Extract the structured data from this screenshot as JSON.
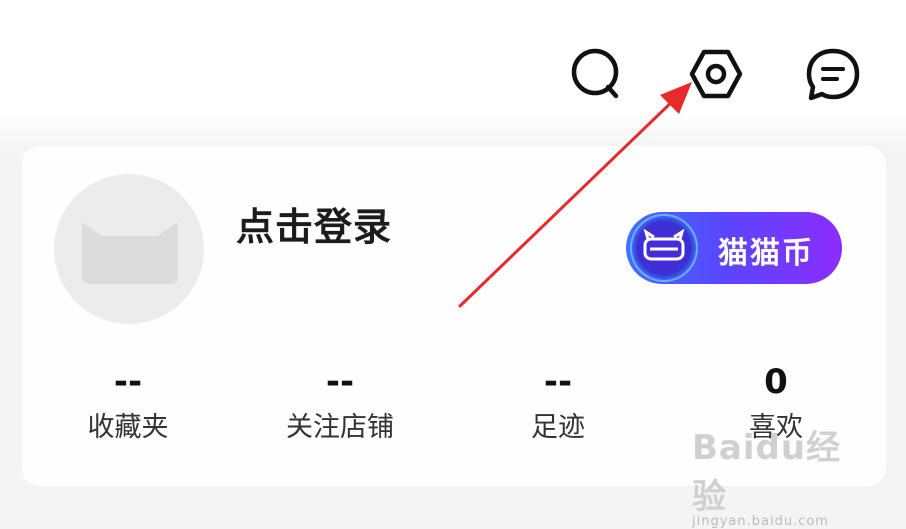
{
  "header": {
    "icons": [
      {
        "name": "search-icon"
      },
      {
        "name": "settings-icon"
      },
      {
        "name": "message-icon"
      }
    ]
  },
  "profile": {
    "login_label": "点击登录"
  },
  "coin_button": {
    "label": "猫猫币"
  },
  "stats": [
    {
      "value": "--",
      "label": "收藏夹"
    },
    {
      "value": "--",
      "label": "关注店铺"
    },
    {
      "value": "--",
      "label": "足迹"
    },
    {
      "value": "0",
      "label": "喜欢"
    }
  ],
  "watermark": {
    "logo": "Baidu经验",
    "url": "jingyan.baidu.com"
  },
  "colors": {
    "arrow": "#e82a2a",
    "coin_gradient_start": "#3b73ff",
    "coin_gradient_end": "#8c2cff"
  }
}
